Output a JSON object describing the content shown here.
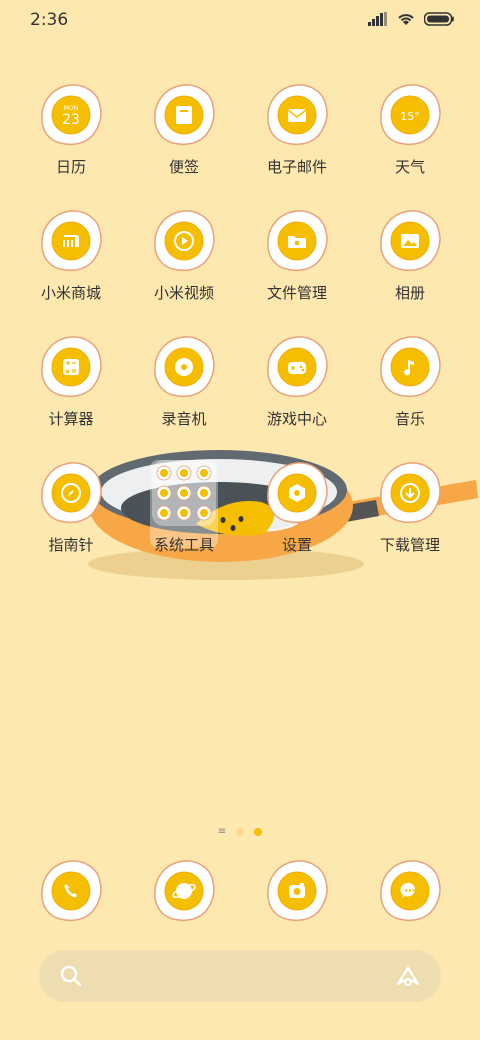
{
  "status": {
    "time": "2:36"
  },
  "apps": [
    {
      "label": "日历",
      "icon": "calendar-icon",
      "month": "MON",
      "day": "23"
    },
    {
      "label": "便签",
      "icon": "notes-icon"
    },
    {
      "label": "电子邮件",
      "icon": "email-icon"
    },
    {
      "label": "天气",
      "icon": "weather-icon",
      "temp": "15°"
    },
    {
      "label": "小米商城",
      "icon": "mi-store-icon",
      "glyph": "mi"
    },
    {
      "label": "小米视频",
      "icon": "video-icon"
    },
    {
      "label": "文件管理",
      "icon": "file-manager-icon"
    },
    {
      "label": "相册",
      "icon": "gallery-icon"
    },
    {
      "label": "计算器",
      "icon": "calculator-icon"
    },
    {
      "label": "录音机",
      "icon": "recorder-icon"
    },
    {
      "label": "游戏中心",
      "icon": "game-center-icon"
    },
    {
      "label": "音乐",
      "icon": "music-icon"
    },
    {
      "label": "指南针",
      "icon": "compass-icon"
    },
    {
      "label": "系统工具",
      "icon": "folder-icon"
    },
    {
      "label": "设置",
      "icon": "settings-icon"
    },
    {
      "label": "下载管理",
      "icon": "download-icon"
    }
  ],
  "dock": [
    {
      "icon": "phone-icon"
    },
    {
      "icon": "browser-icon"
    },
    {
      "icon": "camera-icon"
    },
    {
      "icon": "messages-icon"
    }
  ],
  "pages": {
    "count": 2,
    "active": 1
  },
  "colors": {
    "background": "#FDE8B0",
    "yolk": "#F6BE00",
    "egg_white": "#FFFFFF",
    "outline": "#E8A27A"
  }
}
